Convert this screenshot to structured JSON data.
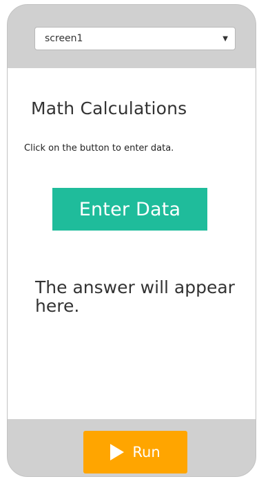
{
  "screen_selector": {
    "selected": "screen1",
    "arrow_icon": "dropdown-arrow-icon"
  },
  "app": {
    "title": "Math Calculations",
    "instruction": "Click on the button to enter data.",
    "enter_button_label": "Enter Data",
    "answer_text": "The answer will appear here."
  },
  "run_control": {
    "label": "Run",
    "icon": "play-icon"
  },
  "colors": {
    "frame": "#d0d0d0",
    "screen_background": "#ffffff",
    "enter_button": "#1fbc9b",
    "run_button": "#ffa500",
    "text": "#333333",
    "button_text": "#ffffff"
  }
}
